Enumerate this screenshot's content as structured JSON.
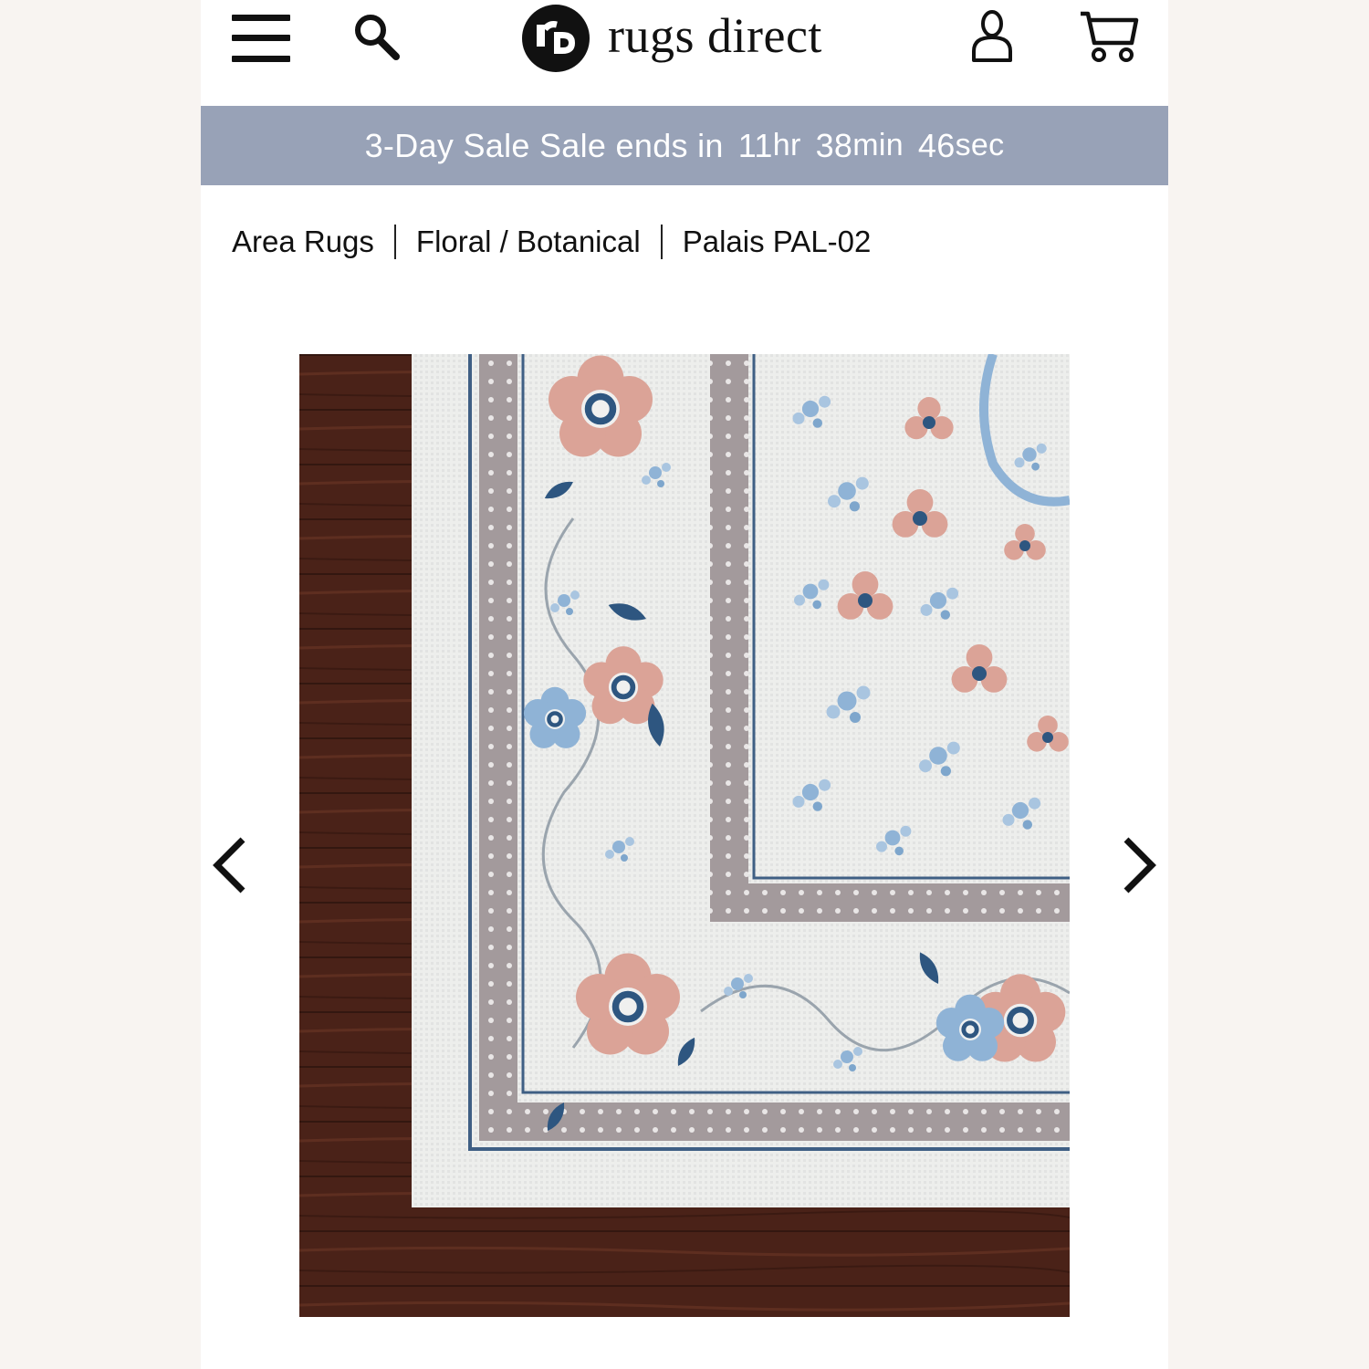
{
  "header": {
    "logo_text": "rugs direct",
    "menu_icon": "hamburger-menu-icon",
    "search_icon": "search-icon",
    "account_icon": "user-icon",
    "cart_icon": "cart-icon"
  },
  "sale_banner": {
    "label": "3-Day Sale Sale ends in",
    "hours": "11",
    "hours_unit": "hr",
    "minutes": "38",
    "minutes_unit": "min",
    "seconds": "46",
    "seconds_unit": "sec"
  },
  "breadcrumb": {
    "items": [
      "Area Rugs",
      "Floral / Botanical",
      "Palais PAL-02"
    ]
  },
  "gallery": {
    "prev_icon": "chevron-left-icon",
    "next_icon": "chevron-right-icon"
  },
  "colors": {
    "banner_bg": "#98a2b7",
    "page_bg": "#f8f4f1",
    "floor_wood": "#4a2218",
    "rug_ivory": "#eeeeec",
    "rug_blue": "#7ea6cc",
    "rug_navy": "#2e5680",
    "rug_blush": "#dba397",
    "rug_taupe": "#9f9597"
  }
}
